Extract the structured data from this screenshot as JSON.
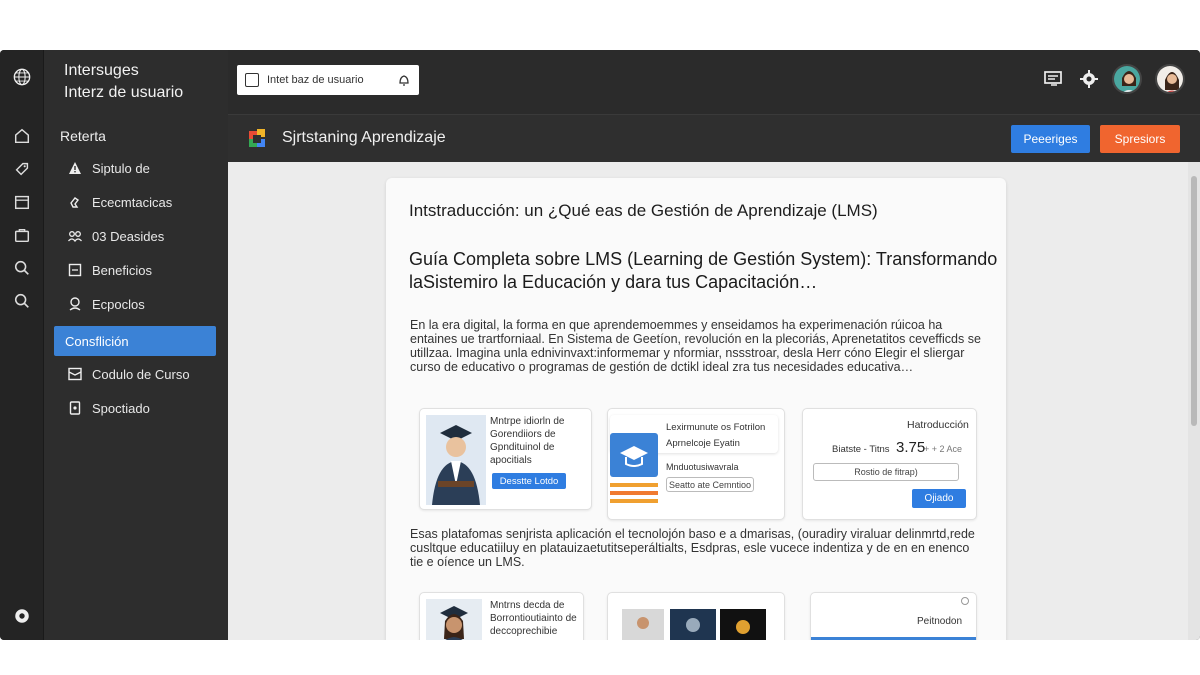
{
  "app": {
    "title_line1": "Intersuges",
    "title_line2": "Interz de usuario"
  },
  "sidebar": {
    "section_label": "Reterta",
    "items": [
      {
        "label": "Siptulo de",
        "icon": "person-warning-icon"
      },
      {
        "label": "Ececmtacicas",
        "icon": "hand-icon"
      },
      {
        "label": "03 Deasides",
        "icon": "group-icon"
      },
      {
        "label": "Beneficios",
        "icon": "document-icon"
      },
      {
        "label": "Ecpoclos",
        "icon": "person-icon"
      },
      {
        "label": "Consflición",
        "icon": "none",
        "active": true
      },
      {
        "label": "Codulo de Curso",
        "icon": "inbox-icon"
      },
      {
        "label": "Spoctiado",
        "icon": "badge-icon"
      }
    ]
  },
  "search": {
    "value": "Intet baz de usuario"
  },
  "header": {
    "title": "Sjrtstaning Aprendizaje",
    "btn_primary": "Peeeriges",
    "btn_secondary": "Spresiors"
  },
  "article": {
    "intro_title": "Intstraducción: un ¿Qué eas de Gestión de Aprendizaje (LMS)",
    "heading": "Guía Completa sobre LMS (Learning de Gestión System): Transformando laSistemiro la Educación y dara tus Capacitación…",
    "para1": "En la era digital, la forma en que aprendemoemmes y enseidamos ha experimenación rúicoa ha entaines ue trartforniaal. En Sistema de Geetíon, revolución en la plecoriás, Aprenetatitos cevefficds se utillzaa. Imagina unla ednivinvaxt:informemar y nformiar, nssstroar, desla Herr cóno Elegir el sliergar curso de educativo o programas de gestión de dctikl ideal zra tus necesidades educativa…",
    "para2": "Esas platafomas senjrista aplicación el tecnolojón baso e a dmarisas, (ouradiry viraluar delinmrtd,rede cusltque educatiiluy en platauizaetutitseperáltialts, Esdpras, esle vucece indentiza y de en en enenco tie e oíence un LMS."
  },
  "cards": {
    "c1": {
      "text": "Mntrpe idiorln de Gorendiiors de Gpndituinol de apocitials",
      "button": "Desstte Lotdo"
    },
    "c2": {
      "line1": "Lexirmunute os Fotrilon",
      "line2": "Aprnelcoje Eyatin",
      "line3": "Mnduotusiwavrala",
      "outline_btn": "Seatto ate Cemntioo"
    },
    "c3": {
      "title": "Hatroducción",
      "value_label": "Biatste - Titns",
      "value": "3.75",
      "value_suffix": "+ + 2 Ace",
      "field": "Rostio de fitrap)",
      "button": "Ojiado"
    },
    "c4": {
      "text": "Mntrns decda de Borrontioutiainto de deccoprechibie"
    },
    "c6": {
      "title": "Peitnodon"
    }
  },
  "colors": {
    "accent_blue": "#2f7de1",
    "accent_orange": "#f0652f",
    "sidebar_active": "#3b82d6"
  }
}
